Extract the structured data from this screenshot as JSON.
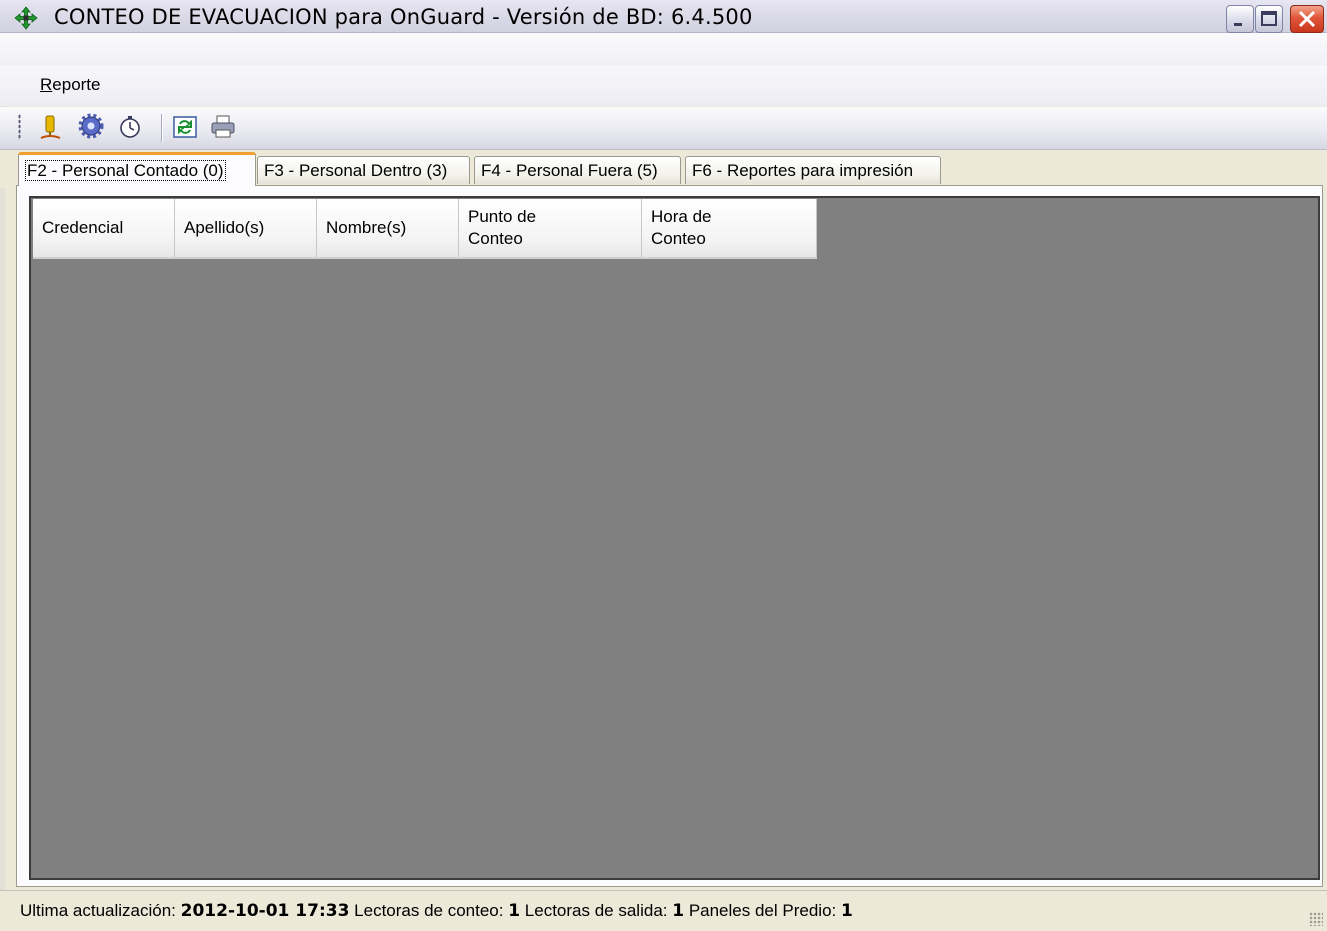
{
  "window": {
    "title": "CONTEO DE EVACUACION para OnGuard - Versión de BD: 6.4.500",
    "app_icon": "evacuation-cross-icon",
    "controls": [
      "minimize-icon",
      "maximize-icon",
      "close-icon"
    ]
  },
  "menu": {
    "items": [
      {
        "mnemonic": "R",
        "rest": "eporte"
      }
    ]
  },
  "toolbar": {
    "buttons": [
      {
        "icon": "reader-person-icon"
      },
      {
        "icon": "gear-icon"
      },
      {
        "icon": "stopwatch-icon"
      },
      {
        "icon": "refresh-icon"
      },
      {
        "icon": "printer-icon"
      }
    ]
  },
  "tabs": [
    {
      "label": "F2 - Personal Contado (0)",
      "active": true
    },
    {
      "label": "F3 - Personal Dentro (3)",
      "active": false
    },
    {
      "label": "F4 - Personal Fuera (5)",
      "active": false
    },
    {
      "label": "F6 - Reportes para impresión",
      "active": false
    }
  ],
  "table": {
    "columns": [
      {
        "line1": "Credencial",
        "line2": ""
      },
      {
        "line1": "Apellido(s)",
        "line2": ""
      },
      {
        "line1": "Nombre(s)",
        "line2": ""
      },
      {
        "line1": "Punto de",
        "line2": "Conteo"
      },
      {
        "line1": "Hora de",
        "line2": "Conteo"
      }
    ],
    "rows": []
  },
  "status": {
    "last_update_label": "Ultima actualización:",
    "last_update_value": "2012-10-01 17:33",
    "count_readers_label": "Lectoras de conteo:",
    "count_readers_value": "1",
    "exit_readers_label": "Lectoras de salida:",
    "exit_readers_value": "1",
    "panels_label": "Paneles del Predio:",
    "panels_value": "1"
  },
  "colors": {
    "active_tab_accent": "#f0a030",
    "list_background": "#808080",
    "close_button": "#e1573a"
  }
}
